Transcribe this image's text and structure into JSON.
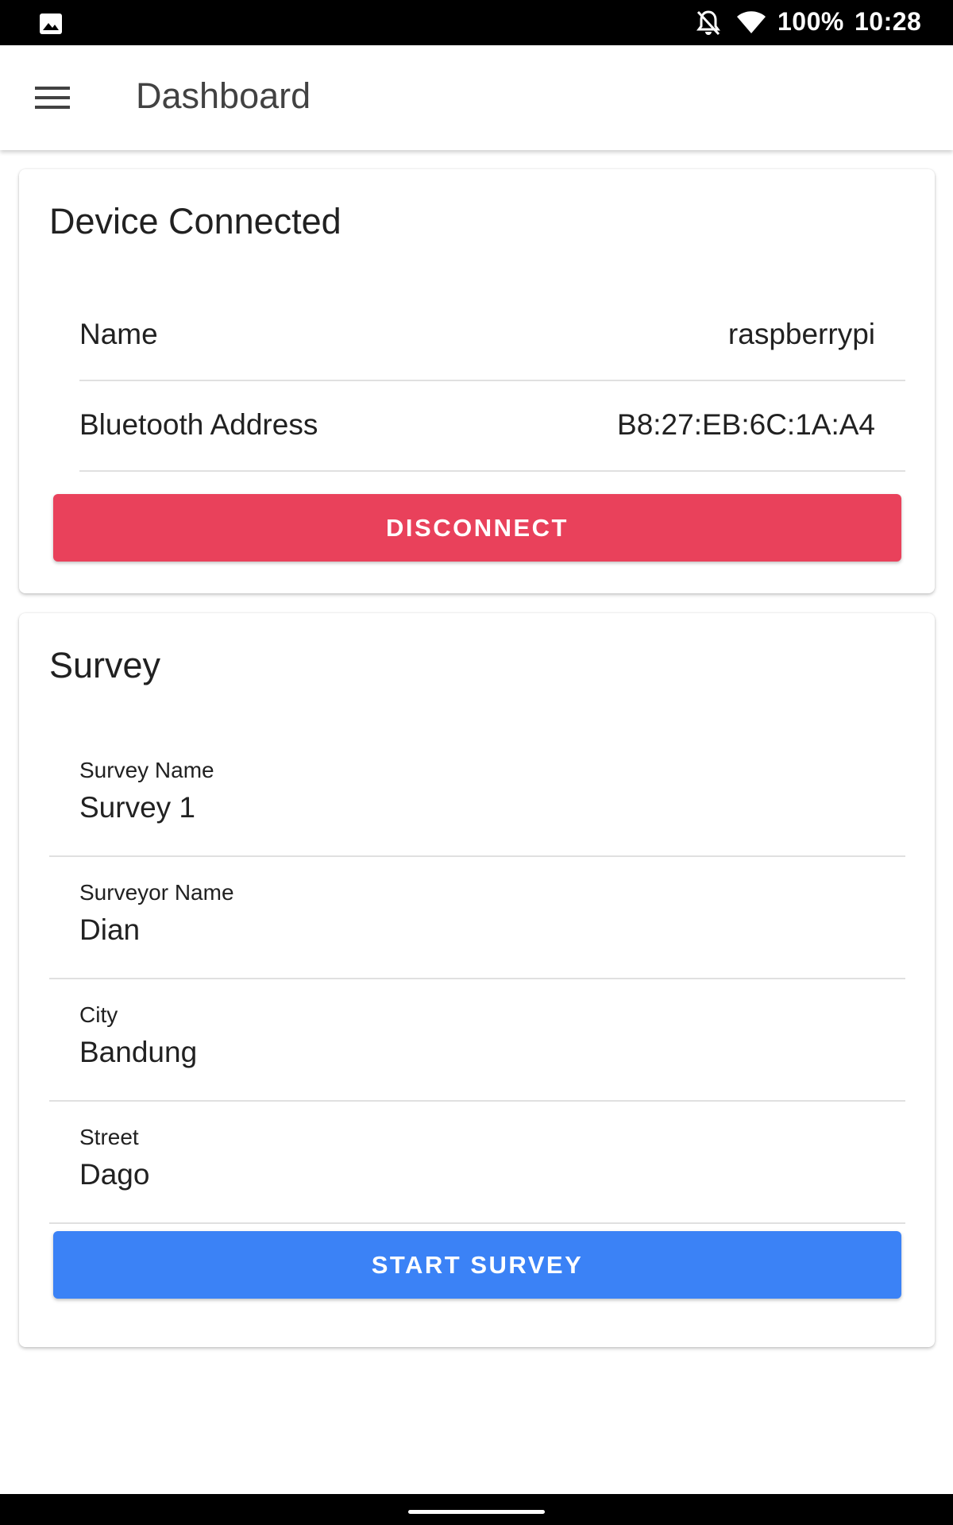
{
  "status_bar": {
    "battery": "100%",
    "time": "10:28",
    "icons": [
      "image-icon",
      "bell-off-icon",
      "wifi-icon"
    ]
  },
  "app_bar": {
    "title": "Dashboard",
    "menu_icon": "hamburger-menu-icon"
  },
  "device_card": {
    "title": "Device Connected",
    "rows": [
      {
        "label": "Name",
        "value": "raspberrypi"
      },
      {
        "label": "Bluetooth Address",
        "value": "B8:27:EB:6C:1A:A4"
      }
    ],
    "disconnect_label": "DISCONNECT"
  },
  "survey_card": {
    "title": "Survey",
    "fields": [
      {
        "label": "Survey Name",
        "value": "Survey 1"
      },
      {
        "label": "Surveyor Name",
        "value": "Dian"
      },
      {
        "label": "City",
        "value": "Bandung"
      },
      {
        "label": "Street",
        "value": "Dago"
      }
    ],
    "start_label": "START SURVEY"
  },
  "colors": {
    "disconnect": "#e9415b",
    "start": "#3b82f6",
    "status_bar": "#000000"
  }
}
